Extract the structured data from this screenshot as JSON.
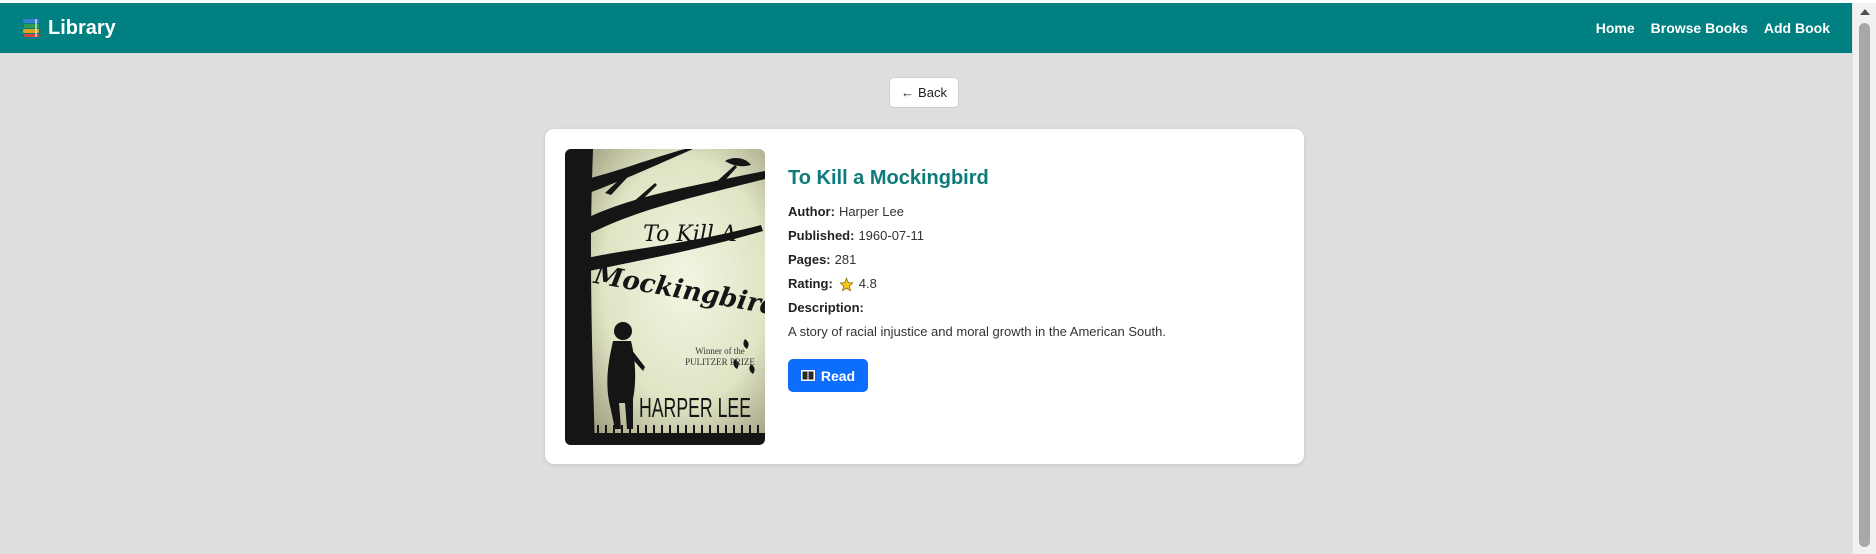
{
  "navbar": {
    "brand": "Library",
    "brand_icon": "books-icon",
    "links": [
      "Home",
      "Browse Books",
      "Add Book"
    ],
    "color": "#008080"
  },
  "back_button": {
    "label": "Back",
    "icon": "left-arrow-icon"
  },
  "book": {
    "title": "To Kill a Mockingbird",
    "author_label": "Author:",
    "author": "Harper Lee",
    "published_label": "Published:",
    "published": "1960-07-11",
    "pages_label": "Pages:",
    "pages": "281",
    "rating_label": "Rating:",
    "rating": "4.8",
    "rating_icon": "star-icon",
    "description_label": "Description:",
    "description": "A story of racial injustice and moral growth in the American South.",
    "cover_text": {
      "title_line1": "To Kill A",
      "title_line2": "Mockingbird",
      "award_line1": "Winner of the",
      "award_line2": "PULITZER PRIZE",
      "author": "HARPER LEE"
    }
  },
  "read_button": {
    "label": "Read",
    "icon": "book-icon",
    "color": "#0d6efd"
  }
}
